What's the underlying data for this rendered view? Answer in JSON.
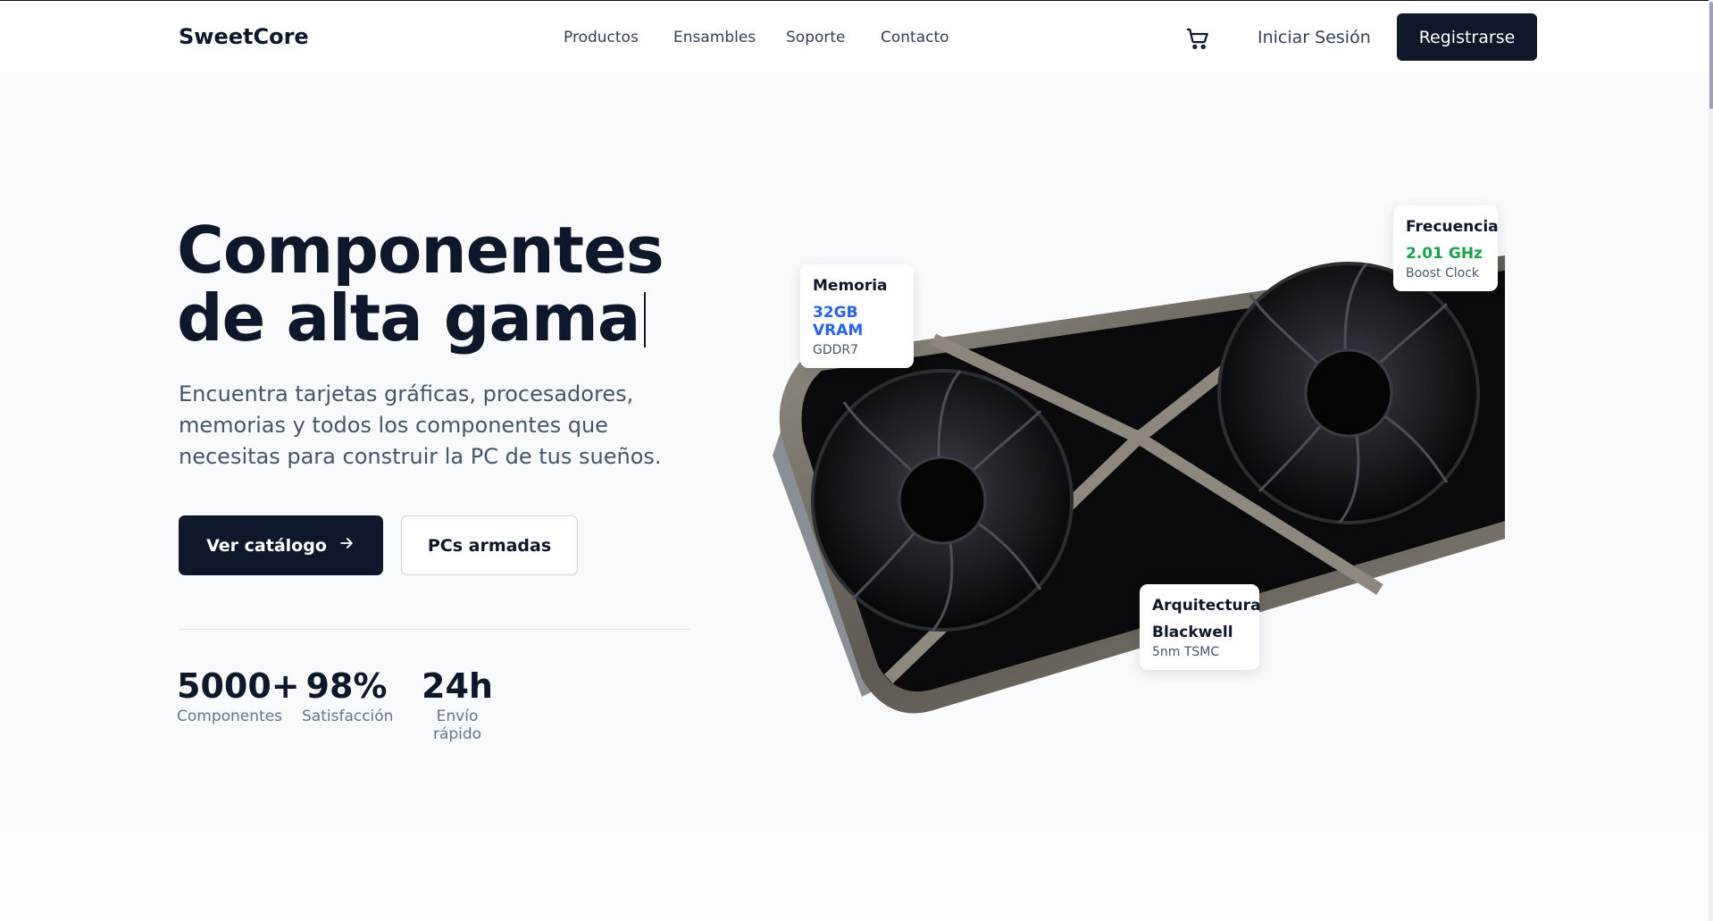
{
  "navbar": {
    "logo": "SweetCore",
    "links": [
      "Productos",
      "Ensambles",
      "Soporte",
      "Contacto"
    ],
    "cart_icon": "cart-icon",
    "login_label": "Iniciar Sesión",
    "signup_label": "Registrarse"
  },
  "hero": {
    "title_line1": "Componentes",
    "title_line2": "de alta gama",
    "subtitle": "Encuentra tarjetas gráficas, procesadores, memorias y todos los componentes que necesitas para construir la PC de tus sueños.",
    "primary_button": "Ver catálogo",
    "primary_button_icon": "arrow-right-icon",
    "secondary_button": "PCs armadas",
    "stats": [
      {
        "value": "5000+",
        "label": "Componentes"
      },
      {
        "value": "98%",
        "label": "Satisfacción"
      },
      {
        "value": "24h",
        "label": "Envío rápido"
      }
    ]
  },
  "specs": {
    "memory": {
      "title": "Memoria",
      "value": "32GB VRAM",
      "sub": "GDDR7",
      "color": "#2563eb"
    },
    "frequency": {
      "title": "Frecuencia",
      "value": "2.01 GHz",
      "sub": "Boost Clock",
      "color": "#16a34a"
    },
    "architecture": {
      "title": "Arquitectura",
      "value": "Blackwell",
      "sub": "5nm TSMC",
      "color": "#0f172a"
    }
  },
  "colors": {
    "primary": "#0f172a",
    "hero_bg": "#f8fafc",
    "text_muted": "#475569"
  }
}
